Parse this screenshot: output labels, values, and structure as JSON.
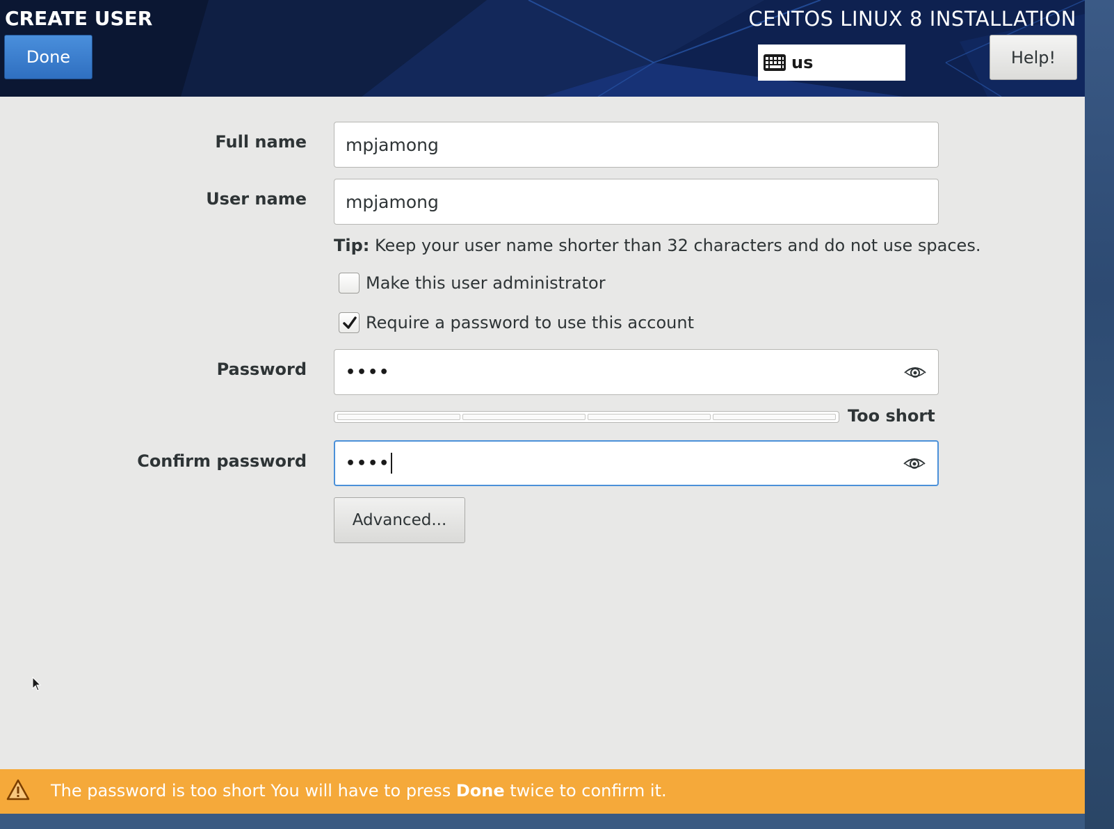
{
  "header": {
    "screen_title": "CREATE USER",
    "product_title": "CENTOS LINUX 8 INSTALLATION",
    "done_label": "Done",
    "keyboard_layout": "us",
    "help_label": "Help!"
  },
  "form": {
    "full_name": {
      "label": "Full name",
      "value": "mpjamong"
    },
    "user_name": {
      "label": "User name",
      "value": "mpjamong"
    },
    "tip": {
      "prefix": "Tip:",
      "text": " Keep your user name shorter than 32 characters and do not use spaces."
    },
    "admin_checkbox": {
      "label": "Make this user administrator",
      "checked": false
    },
    "require_password_checkbox": {
      "label": "Require a password to use this account",
      "checked": true
    },
    "password": {
      "label": "Password",
      "masked_value": "••••"
    },
    "strength": {
      "label": "Too short",
      "level": 0,
      "segments": 4
    },
    "confirm_password": {
      "label": "Confirm password",
      "masked_value": "••••"
    },
    "advanced_label": "Advanced..."
  },
  "warning": {
    "text_before": "The password is too short You will have to press ",
    "bold": "Done",
    "text_after": " twice to confirm it."
  },
  "icons": {
    "keyboard": "keyboard-icon",
    "eye": "eye-icon",
    "warning": "warning-icon",
    "cursor": "mouse-pointer-icon"
  },
  "colors": {
    "header_bg": "#0b1733",
    "done_button": "#3a7fd0",
    "warning_bar": "#f5a93a",
    "focus_border": "#4a90d9",
    "window_bg": "#e8e8e7"
  }
}
